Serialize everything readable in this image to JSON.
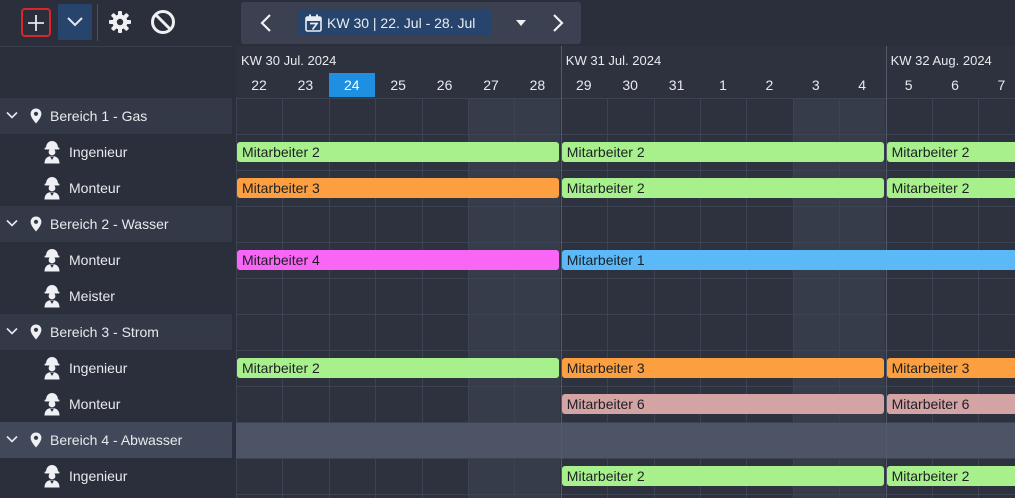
{
  "toolbar": {
    "add_icon": "plus-icon",
    "dropdown_icon": "chevron-down-icon",
    "settings_icon": "gear-icon",
    "block_icon": "ban-icon"
  },
  "navigator": {
    "week_label": "KW 30 | 22. Jul - 28. Jul",
    "calendar_icon": "calendar-icon",
    "prev_icon": "chevron-left-icon",
    "next_icon": "chevron-right-icon"
  },
  "timeline": {
    "weeks": [
      {
        "label": "KW 30 Jul. 2024"
      },
      {
        "label": "KW 31 Jul. 2024"
      },
      {
        "label": "KW 32 Aug. 2024"
      }
    ],
    "days": [
      "22",
      "23",
      "24",
      "25",
      "26",
      "27",
      "28",
      "29",
      "30",
      "31",
      "1",
      "2",
      "3",
      "4",
      "5",
      "6",
      "7"
    ],
    "today": "24"
  },
  "tree": [
    {
      "type": "group",
      "label": "Bereich 1 - Gas"
    },
    {
      "type": "resource",
      "label": "Ingenieur"
    },
    {
      "type": "resource",
      "label": "Monteur"
    },
    {
      "type": "group",
      "label": "Bereich 2 - Wasser"
    },
    {
      "type": "resource",
      "label": "Monteur"
    },
    {
      "type": "resource",
      "label": "Meister"
    },
    {
      "type": "group",
      "label": "Bereich 3 - Strom"
    },
    {
      "type": "resource",
      "label": "Ingenieur"
    },
    {
      "type": "resource",
      "label": "Monteur"
    },
    {
      "type": "group",
      "label": "Bereich 4 - Abwasser"
    },
    {
      "type": "resource",
      "label": "Ingenieur"
    }
  ],
  "assignments": [
    {
      "row": 1,
      "label": "Mitarbeiter 2",
      "color": "#a8f08c",
      "start": "22",
      "end": "28"
    },
    {
      "row": 1,
      "label": "Mitarbeiter 2",
      "color": "#a8f08c",
      "start": "29",
      "end": "4"
    },
    {
      "row": 1,
      "label": "Mitarbeiter 2",
      "color": "#a8f08c",
      "start": "5",
      "end": "7"
    },
    {
      "row": 2,
      "label": "Mitarbeiter 3",
      "color": "#fb9f40",
      "start": "22",
      "end": "28"
    },
    {
      "row": 2,
      "label": "Mitarbeiter 2",
      "color": "#a8f08c",
      "start": "29",
      "end": "4"
    },
    {
      "row": 2,
      "label": "Mitarbeiter 2",
      "color": "#a8f08c",
      "start": "5",
      "end": "7"
    },
    {
      "row": 4,
      "label": "Mitarbeiter 4",
      "color": "#f965f5",
      "start": "22",
      "end": "28"
    },
    {
      "row": 4,
      "label": "Mitarbeiter 1",
      "color": "#5bb9f7",
      "start": "29",
      "end": "7"
    },
    {
      "row": 7,
      "label": "Mitarbeiter 2",
      "color": "#a8f08c",
      "start": "22",
      "end": "28"
    },
    {
      "row": 7,
      "label": "Mitarbeiter 3",
      "color": "#fb9f40",
      "start": "29",
      "end": "4"
    },
    {
      "row": 7,
      "label": "Mitarbeiter 3",
      "color": "#fb9f40",
      "start": "5",
      "end": "7"
    },
    {
      "row": 8,
      "label": "Mitarbeiter 6",
      "color": "#d4a3a3",
      "start": "29",
      "end": "4"
    },
    {
      "row": 8,
      "label": "Mitarbeiter 6",
      "color": "#d4a3a3",
      "start": "5",
      "end": "7"
    },
    {
      "row": 10,
      "label": "Mitarbeiter 2",
      "color": "#a8f08c",
      "start": "29",
      "end": "4"
    },
    {
      "row": 10,
      "label": "Mitarbeiter 2",
      "color": "#a8f08c",
      "start": "5",
      "end": "7"
    }
  ]
}
